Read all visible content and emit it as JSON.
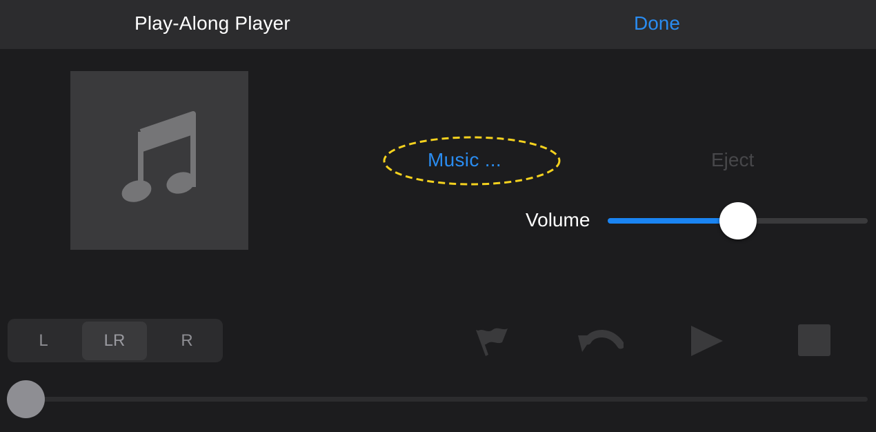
{
  "header": {
    "title": "Play-Along Player",
    "done_label": "Done"
  },
  "artwork": {
    "icon": "music-note-icon"
  },
  "controls": {
    "music_label": "Music ...",
    "eject_label": "Eject",
    "volume_label": "Volume",
    "volume_level": 0.5
  },
  "channels": {
    "items": [
      {
        "label": "L",
        "selected": false
      },
      {
        "label": "LR",
        "selected": true
      },
      {
        "label": "R",
        "selected": false
      }
    ]
  },
  "transport": {
    "icons": [
      "flag-icon",
      "undo-icon",
      "play-icon",
      "stop-icon"
    ]
  },
  "position": {
    "level": 0.0
  },
  "colors": {
    "accent": "#2a8cf0",
    "highlight": "#f5d21e",
    "disabled": "#47474a"
  }
}
